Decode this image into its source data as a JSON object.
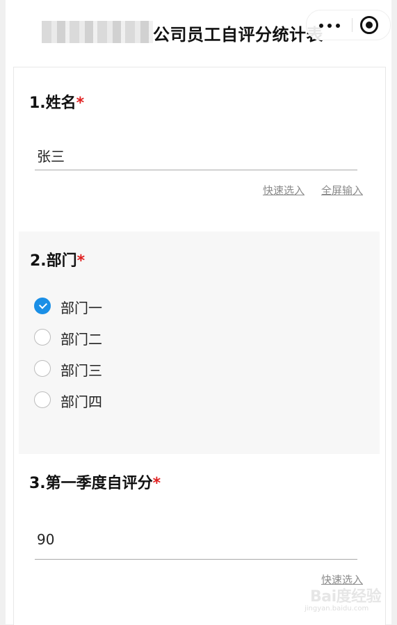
{
  "header": {
    "title": "公司员工自评分统计表",
    "more_icon": "more-dots-icon",
    "close_icon": "target-circle-icon"
  },
  "questions": [
    {
      "title": "1.姓名",
      "required": "*",
      "value": "张三",
      "links": [
        "快速选入",
        "全屏输入"
      ]
    },
    {
      "title": "2.部门",
      "required": "*",
      "options": [
        "部门一",
        "部门二",
        "部门三",
        "部门四"
      ],
      "selected": "部门一"
    },
    {
      "title": "3.第一季度自评分",
      "required": "*",
      "value": "90",
      "links": [
        "快速选入"
      ]
    }
  ],
  "colors": {
    "accent": "#1a8fe6",
    "required": "#e02020",
    "section_bg": "#f7f7f7"
  },
  "watermark": {
    "main": "Bai度经验",
    "sub": "jingyan.baidu.com"
  }
}
